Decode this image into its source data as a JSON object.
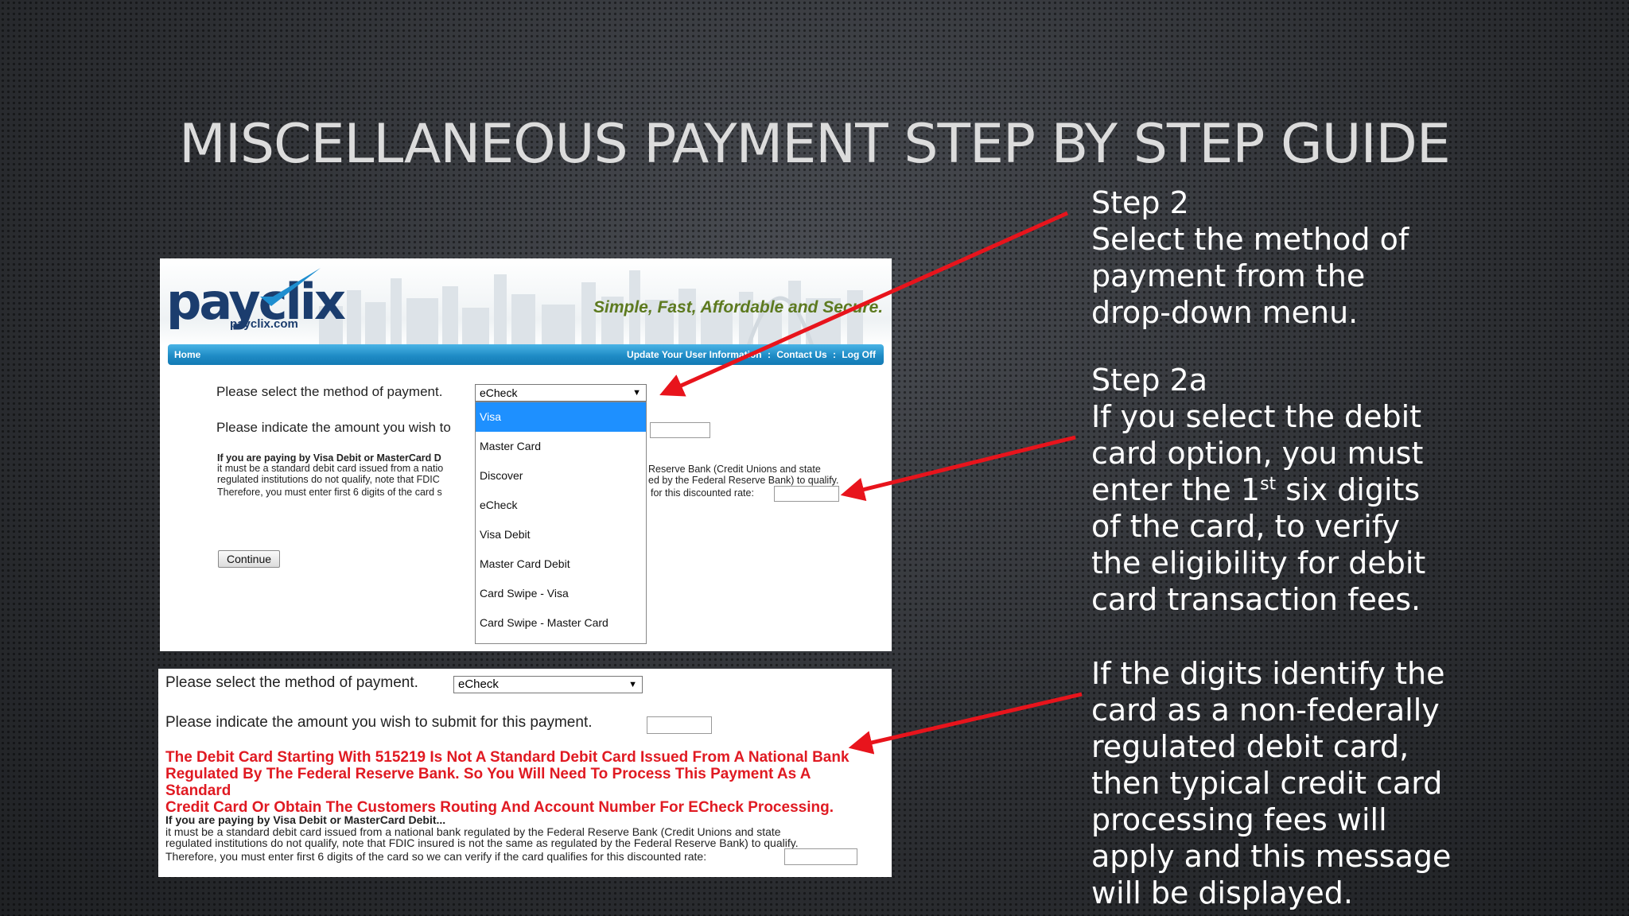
{
  "slide": {
    "title": "Miscellaneous Payment Step by Step Guide"
  },
  "steps": {
    "step2_heading": "Step 2",
    "step2_body": "Select the method of payment from the drop-down menu.",
    "step2a_heading": "Step 2a",
    "step2a_body_pre": "If you select the debit card option, you must enter the 1",
    "step2a_sup": "st",
    "step2a_body_post": " six digits of the card, to verify the eligibility for debit card transaction fees.",
    "step2b_body": "If the digits identify the card as a non-federally regulated debit card, then typical credit card processing fees will apply and this message will be displayed."
  },
  "screenshot1": {
    "logo": "payclix",
    "logo_sub": "payclix.com",
    "tagline": "Simple, Fast, Affordable and Secure.",
    "nav": {
      "home": "Home",
      "update": "Update Your User Information",
      "sep1": ":",
      "contact": "Contact Us",
      "sep2": ":",
      "logoff": "Log Off"
    },
    "method_label": "Please select the method of payment.",
    "method_value": "eCheck",
    "amount_label": "Please indicate the amount you wish to",
    "debit_heading": "If you are paying by Visa Debit or MasterCard D",
    "debit_line1_left": "it must be a standard debit card issued from a natio",
    "debit_line2_left": "regulated institutions do not qualify, note that FDIC",
    "debit_line3_left": "Therefore, you must enter first 6 digits of the card s",
    "debit_line1_right": "Reserve Bank (Credit Unions and state",
    "debit_line2_right": "ed by the Federal Reserve Bank) to qualify.",
    "debit_line3_right": "for this discounted rate:",
    "continue_label": "Continue",
    "dropdown_options": [
      "Visa",
      "Master Card",
      "Discover",
      "eCheck",
      "Visa Debit",
      "Master Card Debit",
      "Card Swipe - Visa",
      "Card Swipe - Master Card"
    ],
    "dropdown_selected": "Visa"
  },
  "screenshot2": {
    "method_label": "Please select the method of payment.",
    "method_value": "eCheck",
    "amount_label": "Please indicate the amount you wish to submit for this payment.",
    "warning_line1": "The Debit Card Starting With 515219 Is Not A Standard Debit Card Issued From A National Bank",
    "warning_line2": "Regulated By The Federal Reserve Bank. So You Will Need To Process This Payment As A Standard",
    "warning_line3": "Credit Card Or Obtain The Customers Routing And Account Number For ECheck Processing.",
    "debit_heading": "If you are paying by Visa Debit or MasterCard Debit...",
    "debit_line1": "it must be a standard debit card issued from a national bank regulated by the Federal Reserve Bank (Credit Unions and state",
    "debit_line2": "regulated institutions do not qualify, note that FDIC insured is not the same as regulated by the Federal Reserve Bank) to qualify.",
    "debit_line3": "Therefore, you must enter first 6 digits of the card so we can verify if the card qualifies for this discounted rate:"
  },
  "colors": {
    "arrow": "#e8141c",
    "warning_text": "#e01a22",
    "nav_bar": "#1f8cc6",
    "dropdown_selected": "#1e90ff"
  },
  "icons": [
    "dropdown-arrow-icon",
    "payclix-check-icon",
    "annotation-arrow-icon"
  ]
}
